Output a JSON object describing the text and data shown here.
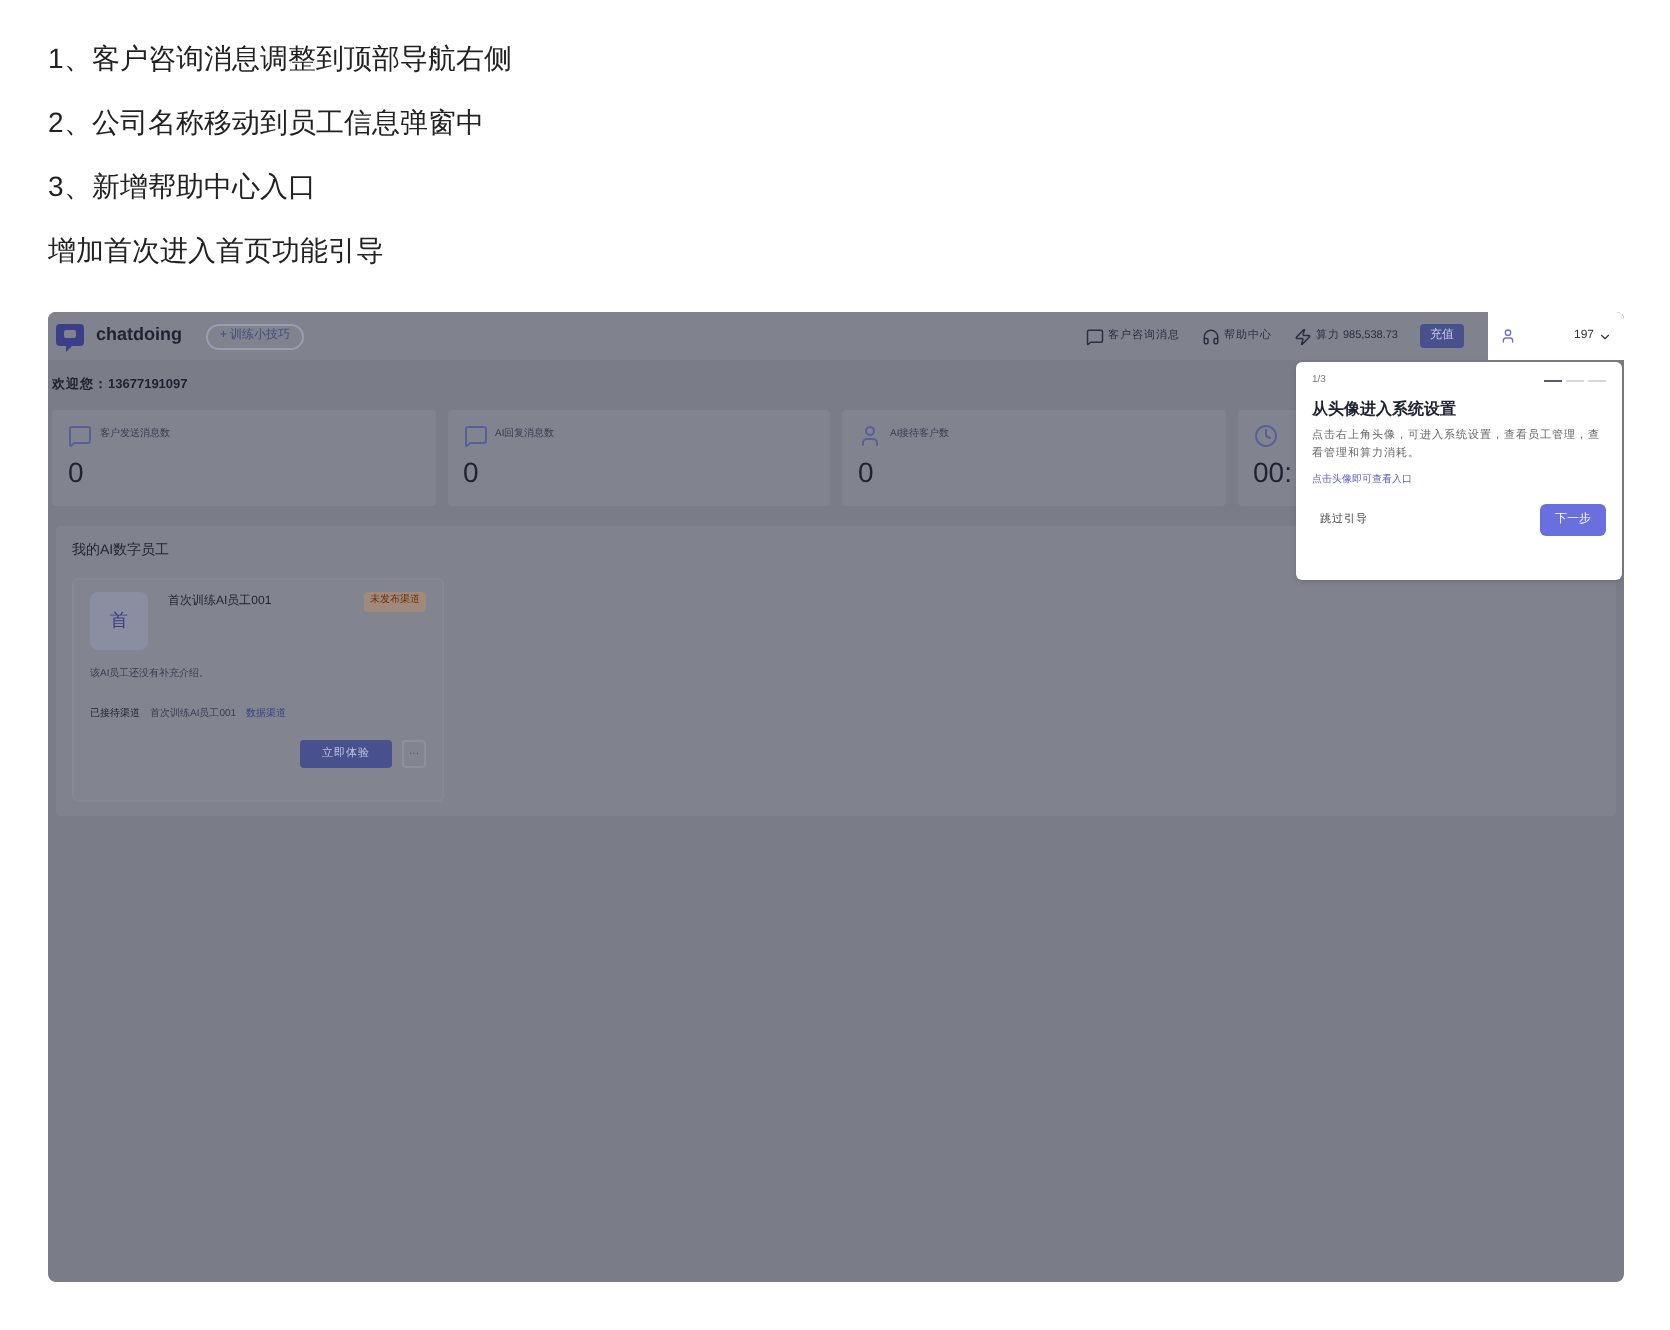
{
  "notes": [
    "1、客户咨询消息调整到顶部导航右侧",
    "2、公司名称移动到员工信息弹窗中",
    "3、新增帮助中心入口",
    "增加首次进入首页功能引导"
  ],
  "screenshot": {
    "header": {
      "logo": "chatdoing",
      "tips_button": "+ 训练小技巧",
      "nav": [
        {
          "kind": "message",
          "label": "客户咨询消息"
        },
        {
          "kind": "help",
          "label": "帮助中心"
        },
        {
          "kind": "balance",
          "label": "算力 985,538.73"
        }
      ],
      "recharge_button": "充值",
      "user": {
        "name": "197"
      }
    },
    "welcome": "欢迎您：13677191097",
    "stats": [
      {
        "kind": "chat",
        "label": "客户发送消息数",
        "value": "0"
      },
      {
        "kind": "chat",
        "label": "AI回复消息数",
        "value": "0"
      },
      {
        "kind": "user",
        "label": "AI接待客户数",
        "value": "0"
      },
      {
        "kind": "clock",
        "value": "00:"
      }
    ],
    "section_title": "我的AI数字员工",
    "employee": {
      "avatar": "首",
      "name": "首次训练AI员工001",
      "badge": "未发布渠道",
      "description": "该AI员工还没有补充介绍。",
      "channel_label": "已接待渠道",
      "channel_value": "首次训练AI员工001",
      "channel_link": "数据渠道",
      "primary_button": "立即体验",
      "more_button": "···"
    },
    "guide": {
      "counter": "1/3",
      "steps": [
        {
          "selected": true
        },
        {
          "selected": false
        },
        {
          "selected": false
        }
      ],
      "title": "从头像进入系统设置",
      "body": "点击右上角头像，可进入系统设置，查看员工管理，查看管理和算力消耗。",
      "hint": "点击头像即可查看入口",
      "skip_button": "跳过引导",
      "next_button": "下一步"
    }
  }
}
